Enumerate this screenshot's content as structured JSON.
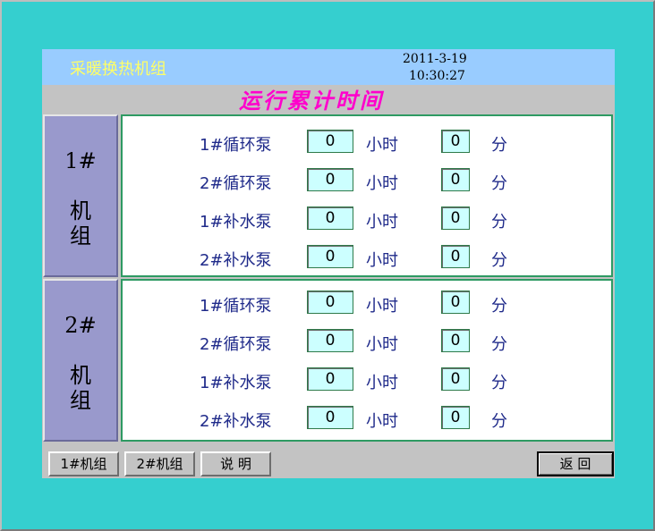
{
  "header": {
    "app_title": "采暖换热机组",
    "date": "2011-3-19",
    "time": "10:30:27",
    "section_title": "运行累计时间"
  },
  "units": [
    {
      "number": "1#",
      "name": "机组",
      "rows": [
        {
          "pump": "1#循环泵",
          "hours": "0",
          "hours_unit": "小时",
          "minutes": "0",
          "minutes_unit": "分"
        },
        {
          "pump": "2#循环泵",
          "hours": "0",
          "hours_unit": "小时",
          "minutes": "0",
          "minutes_unit": "分"
        },
        {
          "pump": "1#补水泵",
          "hours": "0",
          "hours_unit": "小时",
          "minutes": "0",
          "minutes_unit": "分"
        },
        {
          "pump": "2#补水泵",
          "hours": "0",
          "hours_unit": "小时",
          "minutes": "0",
          "minutes_unit": "分"
        }
      ]
    },
    {
      "number": "2#",
      "name": "机组",
      "rows": [
        {
          "pump": "1#循环泵",
          "hours": "0",
          "hours_unit": "小时",
          "minutes": "0",
          "minutes_unit": "分"
        },
        {
          "pump": "2#循环泵",
          "hours": "0",
          "hours_unit": "小时",
          "minutes": "0",
          "minutes_unit": "分"
        },
        {
          "pump": "1#补水泵",
          "hours": "0",
          "hours_unit": "小时",
          "minutes": "0",
          "minutes_unit": "分"
        },
        {
          "pump": "2#补水泵",
          "hours": "0",
          "hours_unit": "小时",
          "minutes": "0",
          "minutes_unit": "分"
        }
      ]
    }
  ],
  "buttons": {
    "unit1": "1#机组",
    "unit2": "2#机组",
    "help": "说 明",
    "back": "返 回"
  },
  "colors": {
    "background": "#35cfcf",
    "title_bar": "#99ccff",
    "app_title": "#ffff66",
    "section_title": "#ff00cc",
    "unit_label_bg": "#9999cc",
    "value_field_bg": "#ccffff",
    "box_border": "#2e9a63"
  }
}
